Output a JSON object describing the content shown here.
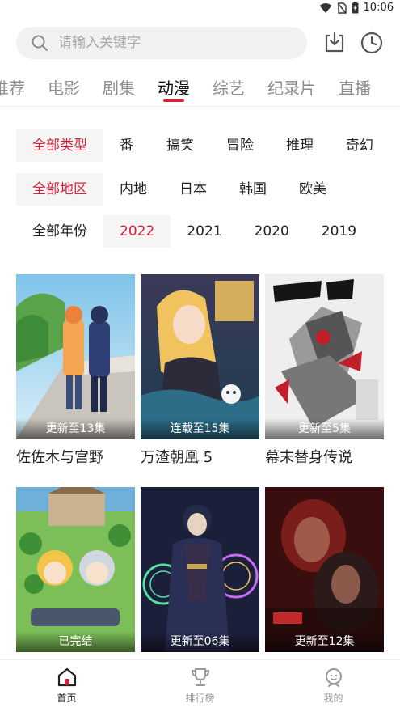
{
  "status_bar": {
    "time": "10:06"
  },
  "search": {
    "placeholder": "请输入关键字"
  },
  "header_icons": [
    "download-icon",
    "history-icon"
  ],
  "categories": [
    "推荐",
    "电影",
    "剧集",
    "动漫",
    "综艺",
    "纪录片",
    "直播"
  ],
  "active_category": "动漫",
  "filters": {
    "type": [
      "全部类型",
      "番",
      "搞笑",
      "冒险",
      "推理",
      "奇幻"
    ],
    "region": [
      "全部地区",
      "内地",
      "日本",
      "韩国",
      "欧美"
    ],
    "year": [
      "全部年份",
      "2022",
      "2021",
      "2020",
      "2019"
    ]
  },
  "items": [
    {
      "title": "佐佐木与宫野",
      "badge": "更新至13集"
    },
    {
      "title": "万渣朝凰 5",
      "badge": "连载至15集"
    },
    {
      "title": "幕末替身传说",
      "badge": "更新至5集"
    },
    {
      "title": "",
      "badge": "已完结"
    },
    {
      "title": "",
      "badge": "更新至06集"
    },
    {
      "title": "",
      "badge": "更新至12集"
    }
  ],
  "bottom_nav": [
    {
      "label": "首页",
      "icon": "home-icon"
    },
    {
      "label": "排行榜",
      "icon": "trophy-icon"
    },
    {
      "label": "我的",
      "icon": "profile-icon"
    }
  ],
  "colors": {
    "accent": "#d8213a",
    "chip_bg": "#f5f5f5",
    "search_bg": "#f1f1f1"
  }
}
